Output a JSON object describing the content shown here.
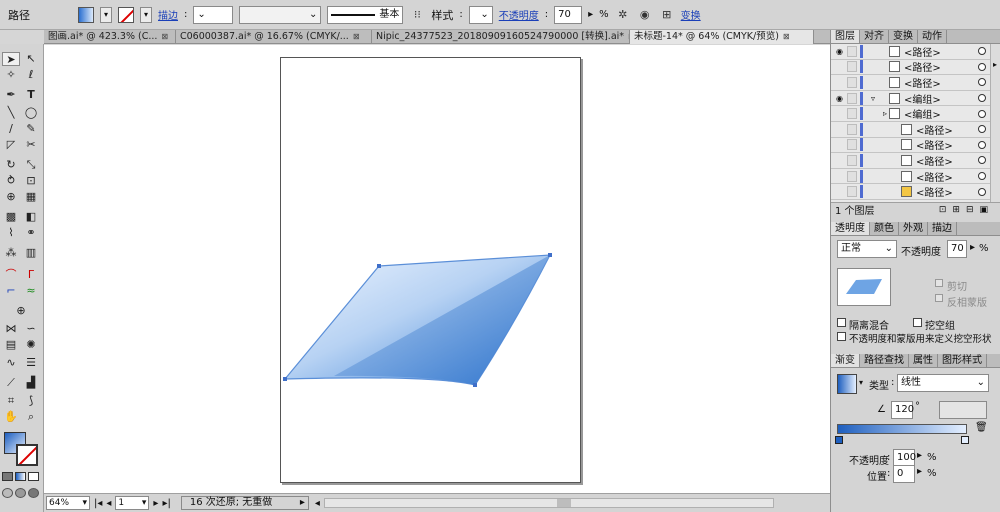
{
  "control_bar": {
    "selection": "路径",
    "stroke_link": "描边",
    "stroke_style": "基本",
    "style_label": "样式",
    "opacity_link": "不透明度",
    "opacity_value": "70",
    "opacity_unit": "%",
    "transform_link": "变换"
  },
  "tabs": [
    {
      "label": "图画.ai* @ 423.3% (C..."
    },
    {
      "label": "C06000387.ai* @ 16.67% (CMYK/..."
    },
    {
      "label": "Nipic_24377523_20180909160524790000 [转换].ai*"
    },
    {
      "label": "未标题-14* @ 64% (CMYK/预览)"
    }
  ],
  "status": {
    "zoom": "64%",
    "page": "1",
    "message": "16 次还原; 无重做"
  },
  "layers_panel": {
    "tabs": [
      "图层",
      "对齐",
      "变换",
      "动作"
    ],
    "rows": [
      {
        "name": "<路径>"
      },
      {
        "name": "<路径>"
      },
      {
        "name": "<路径>"
      },
      {
        "name": "<编组>"
      },
      {
        "name": "<编组>"
      },
      {
        "name": "<路径>"
      },
      {
        "name": "<路径>"
      },
      {
        "name": "<路径>"
      },
      {
        "name": "<路径>"
      },
      {
        "name": "<路径>"
      }
    ],
    "footer": "1 个图层"
  },
  "transparency_panel": {
    "tabs": [
      "透明度",
      "颜色",
      "外观",
      "描边"
    ],
    "blend_mode": "正常",
    "opacity_label": "不透明度",
    "opacity_value": "70",
    "opacity_unit": "%",
    "clip_label": "剪切",
    "invert_mask_label": "反相蒙版",
    "isolate_label": "隔离混合",
    "knockout_label": "挖空组",
    "define_knockout_label": "不透明度和蒙版用来定义挖空形状"
  },
  "gradient_panel": {
    "tabs": [
      "渐变",
      "路径查找",
      "属性",
      "图形样式"
    ],
    "type_label": "类型",
    "type_value": "线性",
    "angle": "120",
    "opacity_label": "不透明度",
    "opacity_value": "100",
    "opacity_unit": "%",
    "location_label": "位置",
    "location_value": "0",
    "location_unit": "%"
  },
  "colors": {
    "shape_light": "#dbe9fb",
    "shape_dark": "#2f7ad4",
    "accent_blue": "#4f6bd1"
  }
}
